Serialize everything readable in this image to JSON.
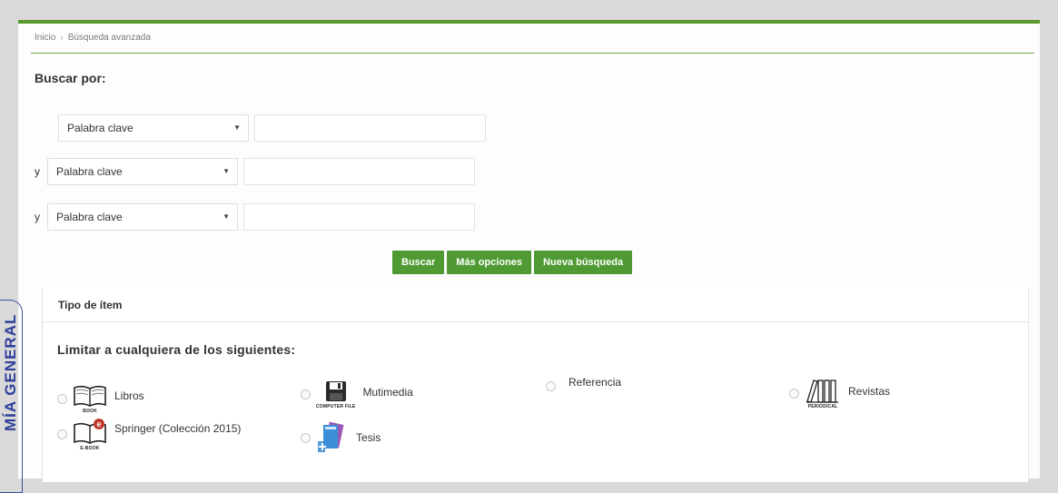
{
  "breadcrumb": {
    "home": "Inicio",
    "current": "Búsqueda avanzada"
  },
  "search": {
    "heading": "Buscar por:",
    "rows": [
      {
        "connector": "",
        "field": "Palabra clave",
        "value": ""
      },
      {
        "connector": "y",
        "field": "Palabra clave",
        "value": ""
      },
      {
        "connector": "y",
        "field": "Palabra clave",
        "value": ""
      }
    ]
  },
  "actions": {
    "search": "Buscar",
    "more": "Más opciones",
    "new": "Nueva búsqueda"
  },
  "item_type": {
    "heading": "Tipo de ítem",
    "limit_text": "Limitar a cualquiera de los siguientes:",
    "items": [
      {
        "label": "Libros",
        "icon": "book-icon",
        "icon_caption": "BOOK"
      },
      {
        "label": "Mutimedia",
        "icon": "floppy-disk-icon",
        "icon_caption": "COMPUTER FILE"
      },
      {
        "label": "Referencia",
        "icon": "",
        "icon_caption": ""
      },
      {
        "label": "Revistas",
        "icon": "periodical-icon",
        "icon_caption": "PERIODICAL"
      },
      {
        "label": "Springer (Colección 2015)",
        "icon": "ebook-icon",
        "icon_caption": "E-BOOK"
      },
      {
        "label": "Tesis",
        "icon": "thesis-icon",
        "icon_caption": ""
      }
    ]
  },
  "stamp": {
    "text": "MÍA GENERAL"
  },
  "colors": {
    "accent": "#4f9a33",
    "rule": "#6aa84f",
    "stamp": "#2e3f9a"
  }
}
